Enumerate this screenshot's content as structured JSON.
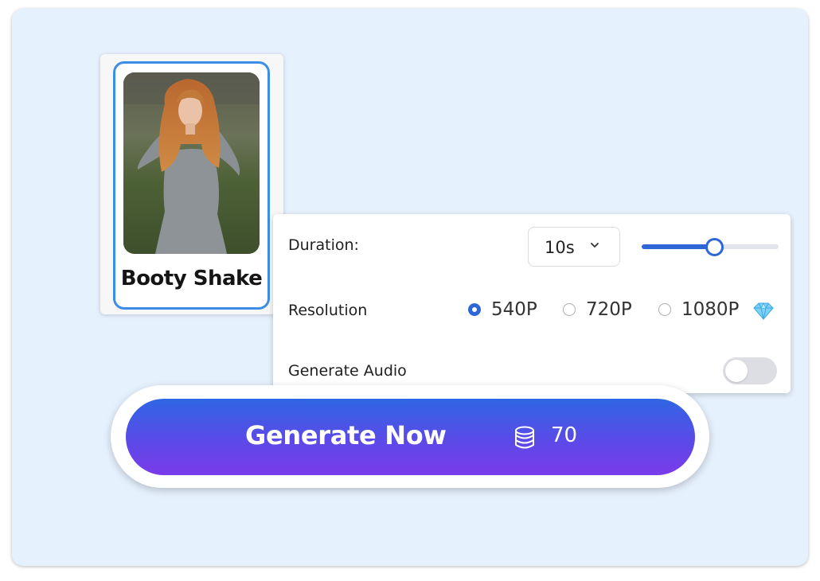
{
  "template": {
    "title": "Booty Shake",
    "image": "woman-in-grey-dress-photo"
  },
  "settings": {
    "duration": {
      "label": "Duration:",
      "value": "10s",
      "slider_fraction": 0.53
    },
    "resolution": {
      "label": "Resolution",
      "options": [
        {
          "label": "540P",
          "selected": true
        },
        {
          "label": "720P",
          "selected": false
        },
        {
          "label": "1080P",
          "selected": false,
          "premium_icon": "diamond-icon"
        }
      ]
    },
    "audio": {
      "label": "Generate Audio",
      "enabled": false
    }
  },
  "generate": {
    "label": "Generate Now",
    "cost_icon": "coin-stack-icon",
    "cost": "70"
  },
  "colors": {
    "background": "#e6f1fe",
    "accent": "#2e66d8",
    "selection_border": "#3c8de8",
    "button_gradient_top": "#2f66e4",
    "button_gradient_bottom": "#7a3bea"
  }
}
